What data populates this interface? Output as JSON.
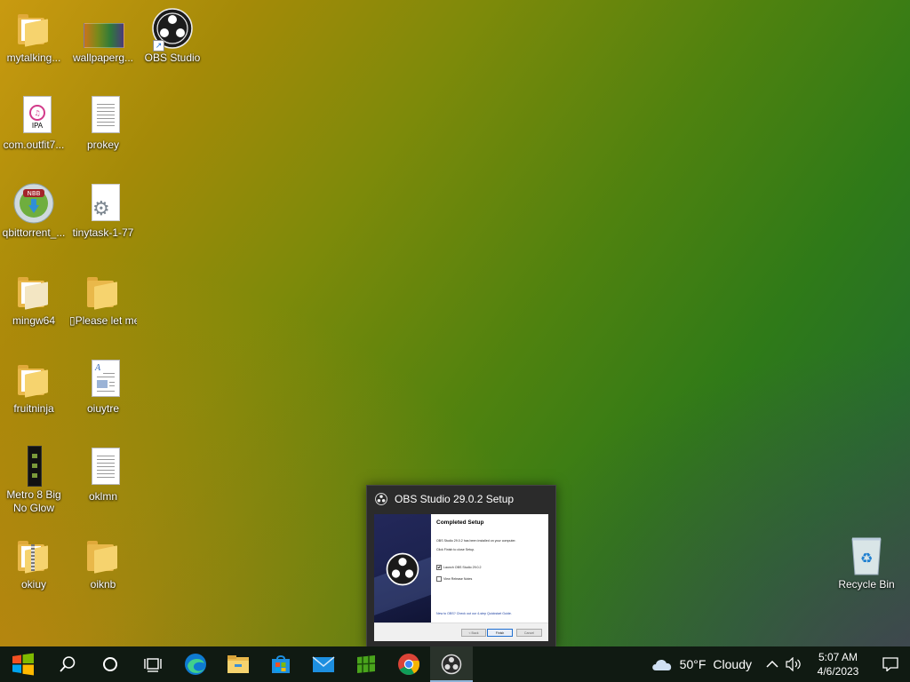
{
  "desktop": {
    "icons": [
      {
        "id": "mytalking",
        "label": "mytalking...",
        "type": "folder"
      },
      {
        "id": "wallpaper",
        "label": "wallpaperg...",
        "type": "image"
      },
      {
        "id": "obs",
        "label": "OBS Studio",
        "type": "obs-shortcut"
      },
      {
        "id": "ipa",
        "label": "com.outfit7...",
        "type": "ipa"
      },
      {
        "id": "prokey",
        "label": "prokey",
        "type": "text"
      },
      {
        "id": "qbittorrent",
        "label": "qbittorrent_...",
        "type": "installer"
      },
      {
        "id": "tinytask",
        "label": "tinytask-1-77",
        "type": "settings-file"
      },
      {
        "id": "mingw64",
        "label": "mingw64",
        "type": "folder"
      },
      {
        "id": "pleaseletme",
        "label": "▯Please let me",
        "type": "folder"
      },
      {
        "id": "fruitninja",
        "label": "fruitninja",
        "type": "folder"
      },
      {
        "id": "oiuytre",
        "label": "oiuytre",
        "type": "word-doc"
      },
      {
        "id": "metro8",
        "label": "Metro 8 Big No Glow",
        "type": "black-file"
      },
      {
        "id": "oklmn",
        "label": "oklmn",
        "type": "text"
      },
      {
        "id": "okiuy",
        "label": "okiuy",
        "type": "zip-folder"
      },
      {
        "id": "oiknb",
        "label": "oiknb",
        "type": "folder"
      },
      {
        "id": "recycle",
        "label": "Recycle Bin",
        "type": "recycle-bin"
      }
    ],
    "ipa_badge": "IPA",
    "qbit_badge": "NBB"
  },
  "setup_window": {
    "title": "OBS Studio 29.0.2 Setup",
    "heading": "Completed Setup",
    "line1": "OBS Studio 29.0.2 has been installed on your computer.",
    "line2": "Click Finish to close Setup.",
    "checkbox_launch": "Launch OBS Studio 29.0.2",
    "checkbox_notes": "View Release Notes",
    "bottom_note": "New to OBS? Check out our 4-step Quickstart Guide.",
    "back_label": "< Back",
    "finish_label": "Finish",
    "cancel_label": "Cancel"
  },
  "taskbar": {
    "pinned": [
      "start-button",
      "search-button",
      "cortana-button",
      "task-view-button",
      "edge-button",
      "file-explorer-button",
      "store-button",
      "mail-button",
      "spreadsheet-app-button",
      "chrome-button",
      "obs-button"
    ],
    "weather_temp": "50°F",
    "weather_cond": "Cloudy",
    "time": "5:07 AM",
    "date": "4/6/2023"
  },
  "colors": {
    "accent": "#1f6fd0",
    "taskbar": "#101a12"
  }
}
